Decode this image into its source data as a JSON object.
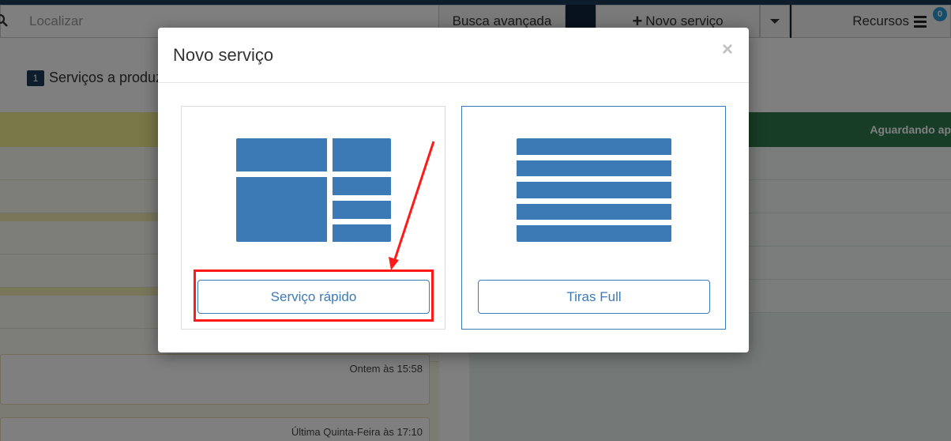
{
  "header": {
    "search_placeholder": "Localizar",
    "advanced_search_label": "Busca avançada",
    "new_service_label": "Novo serviço",
    "resources_label": "Recursos",
    "resources_badge": "0"
  },
  "background": {
    "queue_count": "1",
    "queue_title": "Serviços a produz",
    "right_column_title": "Aguardando ap",
    "card_times": [
      "Ontem às 15:58",
      "Última Quinta-Feira às 17:10"
    ]
  },
  "modal": {
    "title": "Novo serviço",
    "close_symbol": "×",
    "options": [
      {
        "label": "Serviço rápido",
        "icon": "grid-layout-icon"
      },
      {
        "label": "Tiras Full",
        "icon": "horizontal-strips-icon"
      }
    ]
  },
  "annotation": {
    "highlight_color": "#ff1a1a"
  },
  "colors": {
    "accent": "#3c7ab5",
    "nav_bg": "#10253a",
    "column_yellow": "#f2ec8f",
    "column_green": "#2e7a4f"
  }
}
